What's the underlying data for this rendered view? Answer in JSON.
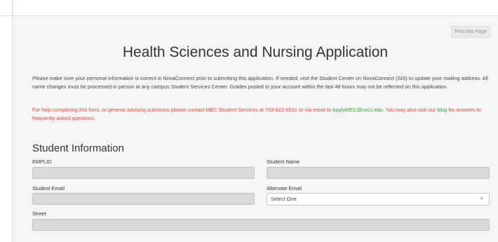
{
  "print_button": "Print this Page",
  "page_title": "Health Sciences and Nursing Application",
  "intro_text": "Please make sure your personal information is correct in NovaConnect prior to submitting this application. If needed, visit the Student Center on NovaConnect (SIS) to update your mailing address. All name changes must be processed in person at any campus Student Services Center. Grades posted to your account within the last 48 hours may not be reflected on this application.",
  "help": {
    "text_1": "For help completing this form, or general advising questions please contact MEC Student Services at 703-822-6531 or via email to ",
    "email": "ApplyMEC@nvcc.edu",
    "text_2": ". You may also visit our ",
    "blog": "blog",
    "text_3": " for answers to frequently asked questions."
  },
  "section_title": "Student Information",
  "fields": {
    "emplid": {
      "label": "EMPLID",
      "value": ""
    },
    "student_name": {
      "label": "Student Name",
      "value": ""
    },
    "student_email": {
      "label": "Student Email",
      "value": ""
    },
    "alternate_email": {
      "label": "Alternate Email",
      "selected": "Select One"
    },
    "street": {
      "label": "Street",
      "value": ""
    }
  },
  "icons": {
    "select_chevron": "chevron-down-icon"
  },
  "colors": {
    "help_text": "#e4473a",
    "link_green": "#3a9a38",
    "panel_bg": "#f5f5f5",
    "input_bg": "#d9d9d9"
  }
}
